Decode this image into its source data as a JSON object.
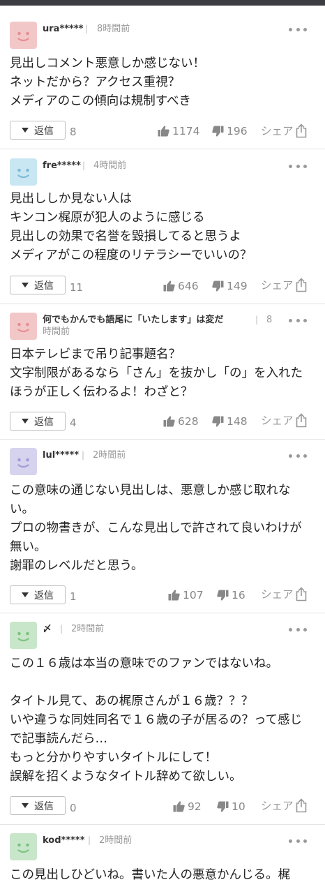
{
  "topbar": {
    "text": ""
  },
  "labels": {
    "reply": "返信",
    "share": "シェア",
    "separator": "|"
  },
  "comments": [
    {
      "user": "ura*****",
      "time": "8時間前",
      "text": "見出しコメント悪意しか感じない！\nネットだから？アクセス重視？\nメディアのこの傾向は規制すべき",
      "replies": "8",
      "likes": "1174",
      "dislikes": "196",
      "avatar_color": "#f2c7c8",
      "face_color": "#e58f93"
    },
    {
      "user": "fre*****",
      "time": "4時間前",
      "text": "見出ししか見ない人は\nキンコン梶原が犯人のように感じる\n見出しの効果で名誉を毀損してると思うよ\nメディアがこの程度のリテラシーでいいの？",
      "replies": "11",
      "likes": "646",
      "dislikes": "149",
      "avatar_color": "#c9e6f3",
      "face_color": "#7fbad6"
    },
    {
      "user": "何でもかんでも語尾に「いたします」は変だ",
      "time_part1": "8",
      "time_part2": "時間前",
      "text": "日本テレビまで吊り記事題名？\n文字制限があるなら「さん」を抜かし「の」を入れたほうが正しく伝わるよ！わざと？",
      "replies": "4",
      "likes": "628",
      "dislikes": "148",
      "avatar_color": "#f2c7c8",
      "face_color": "#e58f93"
    },
    {
      "user": "lul*****",
      "time": "2時間前",
      "text": "この意味の通じない見出しは、悪意しか感じ取れない。\nプロの物書きが、こんな見出しで許されて良いわけが無い。\n謝罪のレベルだと思う。",
      "replies": "1",
      "likes": "107",
      "dislikes": "16",
      "avatar_color": "#d6d3ee",
      "face_color": "#a19cd4"
    },
    {
      "user": "〆",
      "time": "2時間前",
      "text": "この１６歳は本当の意味でのファンではないね。\n\nタイトル見て、あの梶原さんが１６歳？？？\nいや違うな同姓同名で１６歳の子が居るの？って感じで記事読んだら…\nもっと分かりやすいタイトルにして！\n誤解を招くようなタイトル辞めて欲しい。",
      "replies": "0",
      "likes": "92",
      "dislikes": "10",
      "avatar_color": "#c8e6c9",
      "face_color": "#7fc283"
    },
    {
      "user": "kod*****",
      "time": "2時間前",
      "text": "この見出しひどいね。書いた人の悪意かんじる。梶",
      "avatar_color": "#c8e6c9",
      "face_color": "#7fc283"
    }
  ]
}
